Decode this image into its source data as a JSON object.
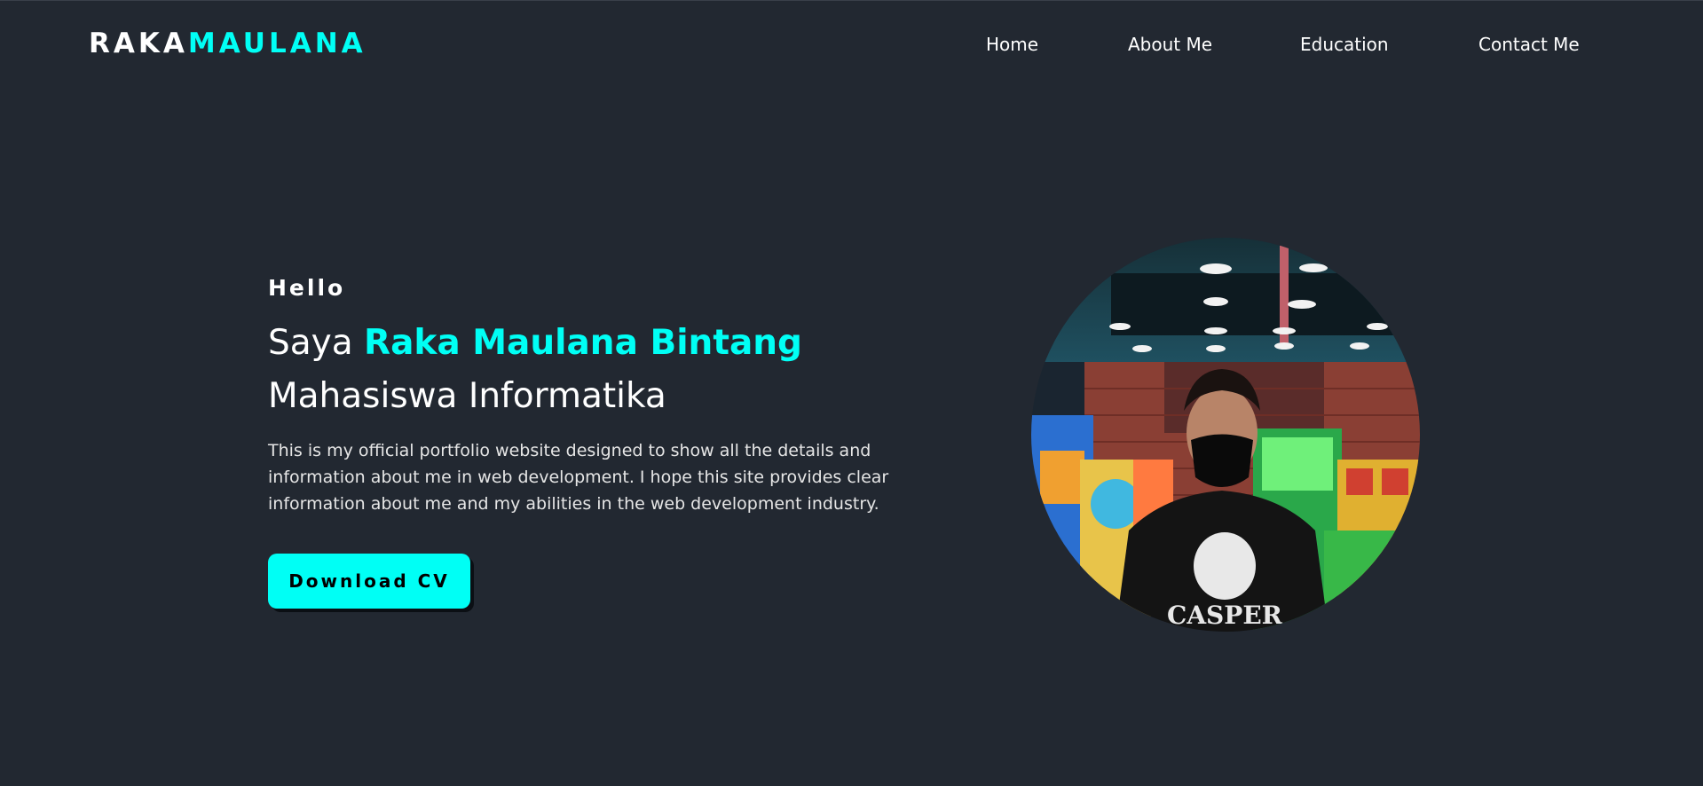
{
  "logo": {
    "part_a": "RAKA",
    "part_b": "MAULANA"
  },
  "nav": {
    "items": [
      {
        "label": "Home"
      },
      {
        "label": "About Me"
      },
      {
        "label": "Education"
      },
      {
        "label": "Contact Me"
      }
    ]
  },
  "hero": {
    "greeting": "Hello",
    "line1_prefix": "Saya",
    "name": "Raka Maulana Bintang",
    "line2": "Mahasiswa Informatika",
    "description": "This is my official portfolio website designed to show all the details and information about me in web development. I hope this site provides clear information about me and my abilities in the web development industry.",
    "cv_button": "Download CV"
  },
  "photo": {
    "hoodie_text": "CASPER"
  },
  "colors": {
    "background": "#222831",
    "accent": "#00fff5",
    "text": "#ffffff"
  }
}
